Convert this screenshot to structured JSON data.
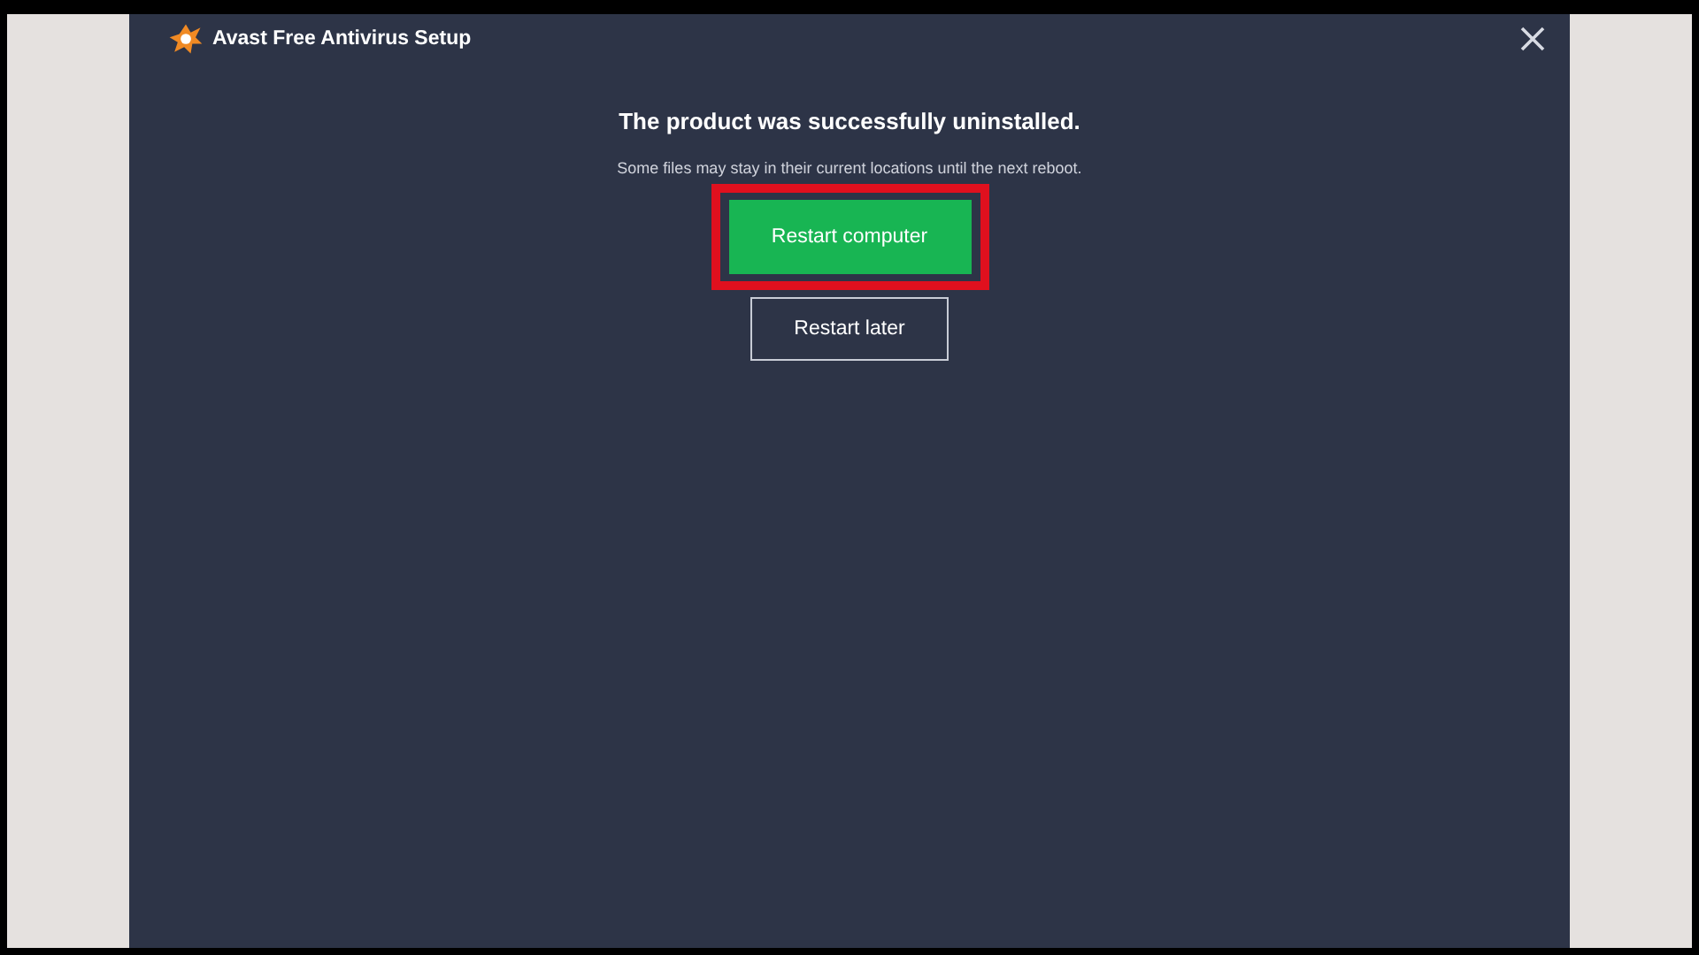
{
  "window": {
    "title": "Avast Free Antivirus Setup"
  },
  "message": {
    "heading": "The product was successfully uninstalled.",
    "note": "Some files may stay in their current locations until the next reboot."
  },
  "buttons": [
    {
      "label": "Restart computer",
      "kind": "primary",
      "highlighted": true
    },
    {
      "label": "Restart later",
      "kind": "secondary",
      "highlighted": false
    }
  ]
}
